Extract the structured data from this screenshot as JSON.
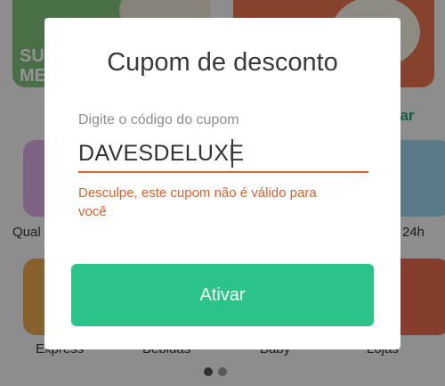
{
  "background": {
    "banner_left_text": "SU\nME",
    "link_text": "car",
    "categories": [
      {
        "label": "Qual"
      },
      {
        "label": "24h"
      },
      {
        "label": "Express"
      },
      {
        "label": "Bebidas"
      },
      {
        "label": "Baby"
      },
      {
        "label": "Lojas"
      }
    ]
  },
  "dialog": {
    "title": "Cupom de desconto",
    "field_label": "Digite o código do cupom",
    "field_value": "DAVESDELUXE",
    "error_message": "Desculpe, este cupom não é válido para você",
    "primary_button": "Ativar"
  },
  "colors": {
    "accent": "#2ac38a",
    "error": "#d0632f"
  }
}
